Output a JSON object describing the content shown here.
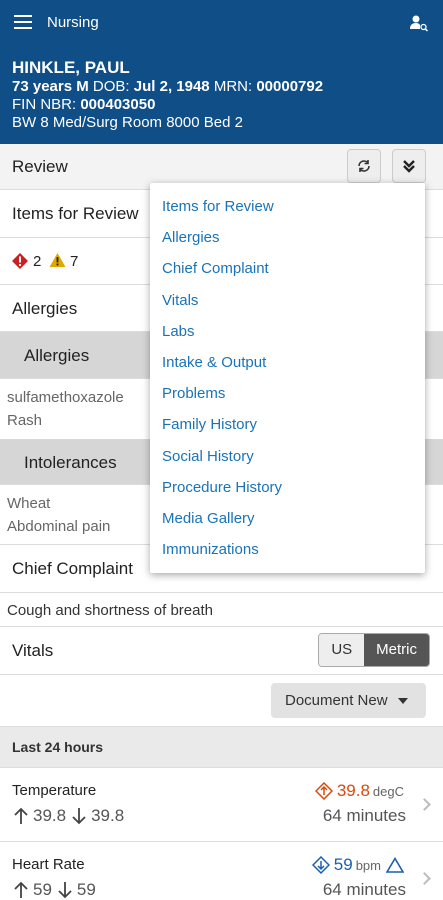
{
  "header": {
    "title": "Nursing",
    "icons": [
      "hamburger-icon",
      "person-search-icon"
    ]
  },
  "patient": {
    "name": "HINKLE, PAUL",
    "age_sex": "73 years M",
    "dob_label": "DOB:",
    "dob": "Jul 2, 1948",
    "mrn_label": "MRN:",
    "mrn": "00000792",
    "fin_label": "FIN NBR:",
    "fin": "000403050",
    "location": "BW 8 Med/Surg Room 8000 Bed 2"
  },
  "review": {
    "title": "Review"
  },
  "items_for_review": {
    "title": "Items for Review",
    "error_count": "2",
    "warning_count": "7"
  },
  "allergies": {
    "title": "Allergies",
    "sub_header": "Allergies",
    "item_name": "sulfamethoxazole",
    "item_reaction": "Rash"
  },
  "intolerances": {
    "sub_header": "Intolerances",
    "item_name": "Wheat",
    "item_reaction": "Abdominal pain"
  },
  "chief_complaint": {
    "title": "Chief Complaint",
    "text": "Cough and shortness of breath"
  },
  "vitals": {
    "title": "Vitals",
    "units": {
      "us": "US",
      "metric": "Metric",
      "selected": "Metric"
    },
    "document_button": "Document New",
    "period": "Last 24 hours",
    "temperature": {
      "label": "Temperature",
      "high": "39.8",
      "low": "39.8",
      "value": "39.8",
      "unit": "degC",
      "time": "64 minutes",
      "color": "#d9480f"
    },
    "heart_rate": {
      "label": "Heart Rate",
      "high": "59",
      "low": "59",
      "value": "59",
      "unit": "bpm",
      "time": "64 minutes",
      "color": "#1a5fb4"
    }
  },
  "dropdown_menu": [
    "Items for Review",
    "Allergies",
    "Chief Complaint",
    "Vitals",
    "Labs",
    "Intake & Output",
    "Problems",
    "Family History",
    "Social History",
    "Procedure History",
    "Media Gallery",
    "Immunizations"
  ],
  "colors": {
    "header_bg": "#0f4e86",
    "link": "#1a73b8",
    "error": "#cc1f1f",
    "warning": "#e0a800"
  }
}
